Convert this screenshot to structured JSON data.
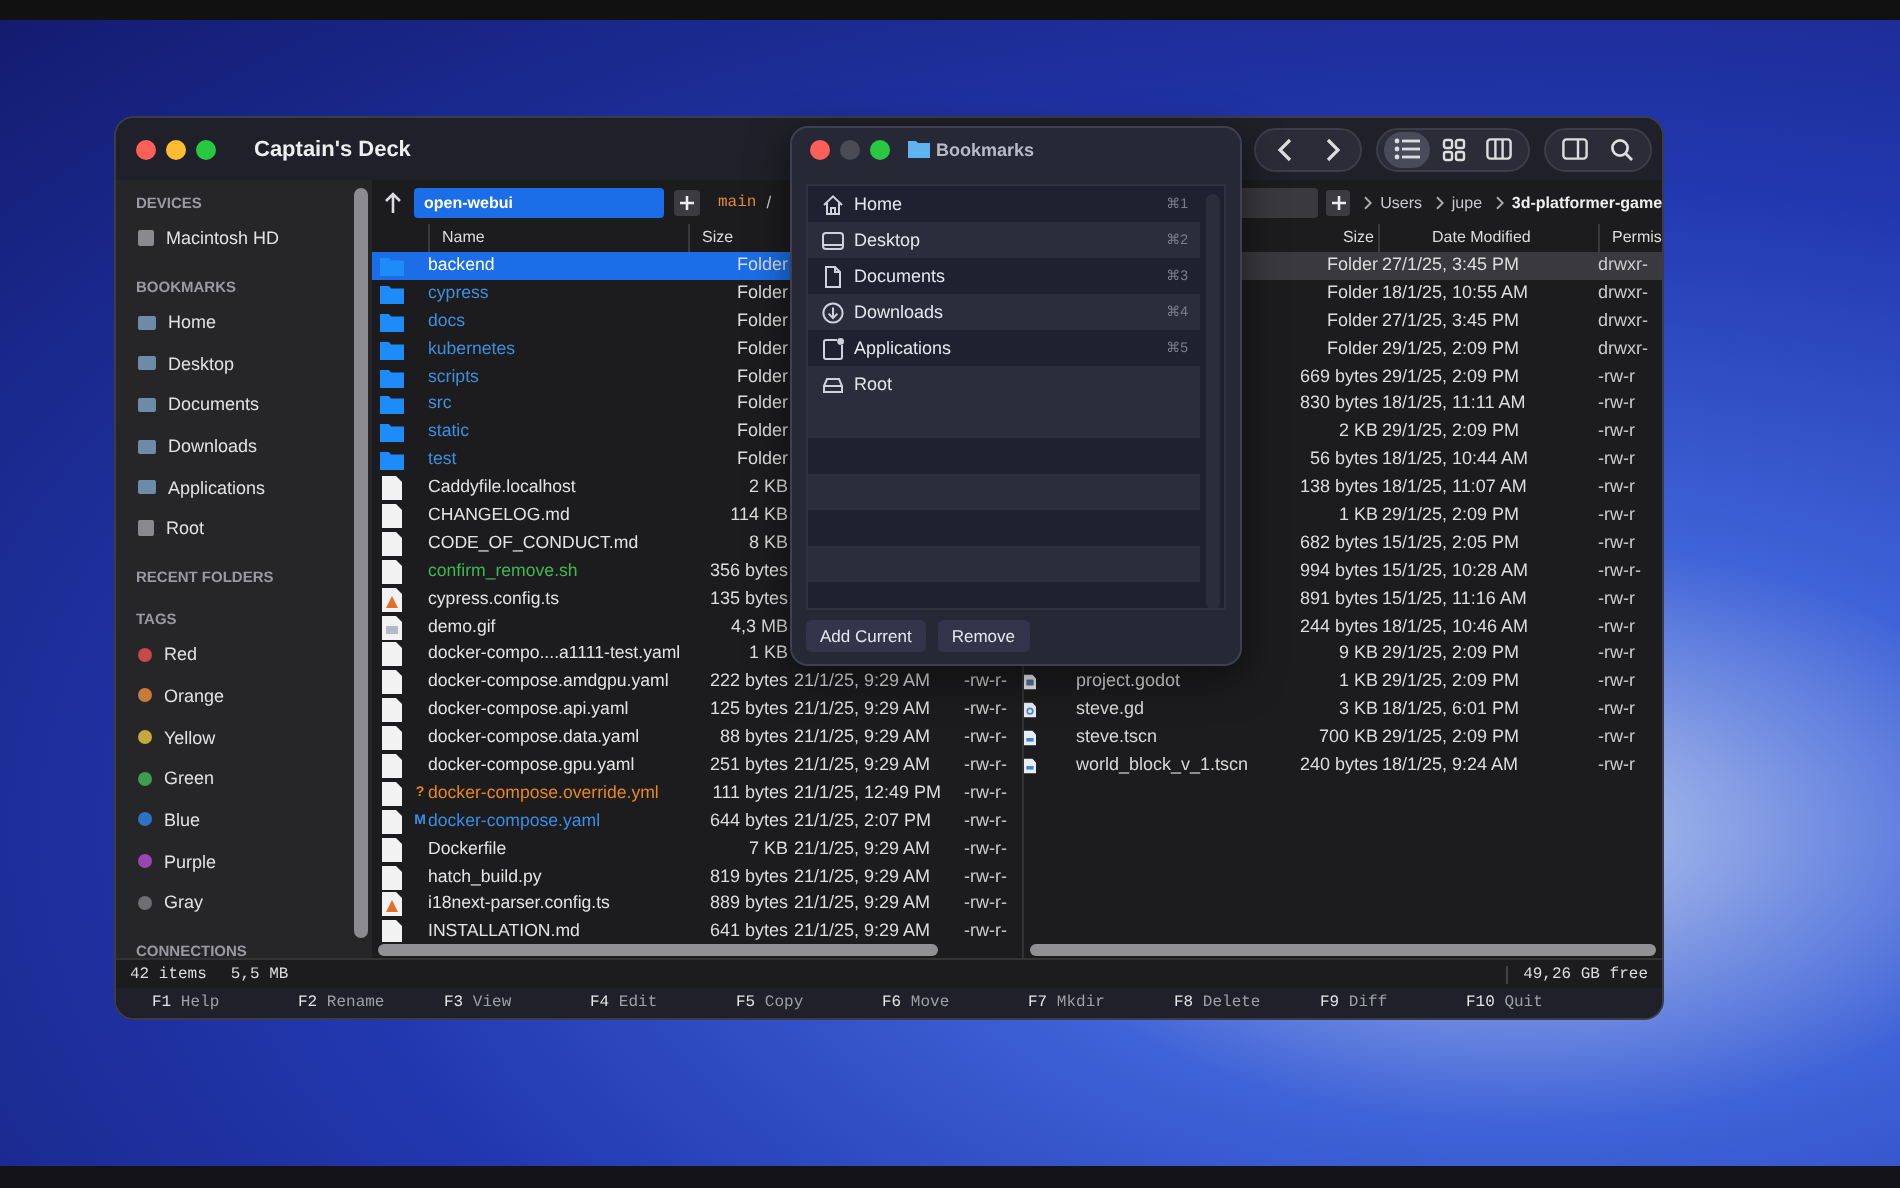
{
  "window": {
    "title": "Captain's Deck"
  },
  "toolbar": {
    "view_modes": [
      {
        "kind": "list",
        "selected": true
      },
      {
        "kind": "grid",
        "selected": false
      },
      {
        "kind": "columns",
        "selected": false
      }
    ]
  },
  "sidebar": {
    "sections": [
      {
        "heading": "DEVICES",
        "items": [
          {
            "label": "Macintosh HD",
            "kind": "drive"
          }
        ]
      },
      {
        "heading": "BOOKMARKS",
        "items": [
          {
            "label": "Home",
            "kind": "folder"
          },
          {
            "label": "Desktop",
            "kind": "folder"
          },
          {
            "label": "Documents",
            "kind": "folder"
          },
          {
            "label": "Downloads",
            "kind": "folder"
          },
          {
            "label": "Applications",
            "kind": "folder"
          },
          {
            "label": "Root",
            "kind": "drive"
          }
        ]
      },
      {
        "heading": "RECENT FOLDERS"
      },
      {
        "heading": "TAGS",
        "items": [
          {
            "label": "Red",
            "kind": "tag",
            "color": "#c9484b"
          },
          {
            "label": "Orange",
            "kind": "tag",
            "color": "#c77a3a"
          },
          {
            "label": "Yellow",
            "kind": "tag",
            "color": "#c2a93a"
          },
          {
            "label": "Green",
            "kind": "tag",
            "color": "#3e9d4f"
          },
          {
            "label": "Blue",
            "kind": "tag",
            "color": "#2f72c4"
          },
          {
            "label": "Purple",
            "kind": "tag",
            "color": "#9a45b0"
          },
          {
            "label": "Gray",
            "kind": "tag",
            "color": "#6e6e73"
          }
        ]
      },
      {
        "heading": "CONNECTIONS"
      }
    ]
  },
  "left_panel": {
    "focused": true,
    "path": "open-webui",
    "branch": "main",
    "branch_separator": "/",
    "columns": [
      "Name",
      "Size"
    ],
    "rows": [
      {
        "name": "backend",
        "size": "Folder",
        "kind": "folder",
        "selected": true
      },
      {
        "name": "cypress",
        "size": "Folder",
        "kind": "folder",
        "selected": false
      },
      {
        "name": "docs",
        "size": "Folder",
        "kind": "folder",
        "selected": false
      },
      {
        "name": "kubernetes",
        "size": "Folder",
        "kind": "folder",
        "selected": false
      },
      {
        "name": "scripts",
        "size": "Folder",
        "kind": "folder",
        "selected": false
      },
      {
        "name": "src",
        "size": "Folder",
        "kind": "folder",
        "selected": false
      },
      {
        "name": "static",
        "size": "Folder",
        "kind": "folder",
        "selected": false
      },
      {
        "name": "test",
        "size": "Folder",
        "kind": "folder",
        "selected": false
      },
      {
        "name": "Caddyfile.localhost",
        "size": "2 KB",
        "kind": "file",
        "selected": false
      },
      {
        "name": "CHANGELOG.md",
        "size": "114 KB",
        "kind": "file",
        "selected": false
      },
      {
        "name": "CODE_OF_CONDUCT.md",
        "size": "8 KB",
        "kind": "file",
        "selected": false
      },
      {
        "name": "confirm_remove.sh",
        "size": "356 bytes",
        "kind": "file",
        "selected": false,
        "color": "#3fb950"
      },
      {
        "name": "cypress.config.ts",
        "size": "135 bytes",
        "kind": "config",
        "selected": false
      },
      {
        "name": "demo.gif",
        "size": "4,3 MB",
        "kind": "image",
        "selected": false
      },
      {
        "name": "docker-compo....a1111-test.yaml",
        "size": "1 KB",
        "kind": "file",
        "selected": false
      },
      {
        "name": "docker-compose.amdgpu.yaml",
        "size": "222 bytes",
        "date": "21/1/25, 9:29 AM",
        "permissions": "-rw-r-",
        "kind": "file",
        "selected": false
      },
      {
        "name": "docker-compose.api.yaml",
        "size": "125 bytes",
        "date": "21/1/25, 9:29 AM",
        "permissions": "-rw-r-",
        "kind": "file",
        "selected": false
      },
      {
        "name": "docker-compose.data.yaml",
        "size": "88 bytes",
        "date": "21/1/25, 9:29 AM",
        "permissions": "-rw-r-",
        "kind": "file",
        "selected": false
      },
      {
        "name": "docker-compose.gpu.yaml",
        "size": "251 bytes",
        "date": "21/1/25, 9:29 AM",
        "permissions": "-rw-r-",
        "kind": "file",
        "selected": false
      },
      {
        "name": "docker-compose.override.yml",
        "size": "111 bytes",
        "date": "21/1/25, 12:49 PM",
        "permissions": "-rw-r-",
        "kind": "file",
        "selected": false,
        "color": "#e8871e",
        "git_status": "?"
      },
      {
        "name": "docker-compose.yaml",
        "size": "644 bytes",
        "date": "21/1/25, 2:07 PM",
        "permissions": "-rw-r-",
        "kind": "file",
        "selected": false,
        "color": "#3a8ee6",
        "git_status": "M"
      },
      {
        "name": "Dockerfile",
        "size": "7 KB",
        "date": "21/1/25, 9:29 AM",
        "permissions": "-rw-r-",
        "kind": "file",
        "selected": false
      },
      {
        "name": "hatch_build.py",
        "size": "819 bytes",
        "date": "21/1/25, 9:29 AM",
        "permissions": "-rw-r-",
        "kind": "file",
        "selected": false
      },
      {
        "name": "i18next-parser.config.ts",
        "size": "889 bytes",
        "date": "21/1/25, 9:29 AM",
        "permissions": "-rw-r-",
        "kind": "config",
        "selected": false
      },
      {
        "name": "INSTALLATION.md",
        "size": "641 bytes",
        "date": "21/1/25, 9:29 AM",
        "permissions": "-rw-r-",
        "kind": "file",
        "selected": false
      }
    ]
  },
  "right_panel": {
    "focused": false,
    "breadcrumb": [
      "Users",
      "jupe",
      "3d-platformer-game"
    ],
    "columns": [
      "Size",
      "Date Modified",
      "Permis"
    ],
    "rows": [
      {
        "size": "Folder",
        "date": "27/1/25, 3:45 PM",
        "permissions": "drwxr-",
        "selected": true
      },
      {
        "size": "Folder",
        "date": "18/1/25, 10:55 AM",
        "permissions": "drwxr-",
        "selected": false
      },
      {
        "size": "Folder",
        "date": "27/1/25, 3:45 PM",
        "permissions": "drwxr-",
        "selected": false
      },
      {
        "size": "Folder",
        "date": "29/1/25, 2:09 PM",
        "permissions": "drwxr-",
        "selected": false
      },
      {
        "size": "669 bytes",
        "date": "29/1/25, 2:09 PM",
        "permissions": "-rw-r",
        "selected": false
      },
      {
        "size": "830 bytes",
        "date": "18/1/25, 11:11 AM",
        "permissions": "-rw-r",
        "selected": false
      },
      {
        "size": "2 KB",
        "date": "29/1/25, 2:09 PM",
        "permissions": "-rw-r",
        "selected": false
      },
      {
        "size": "56 bytes",
        "date": "18/1/25, 10:44 AM",
        "permissions": "-rw-r",
        "selected": false
      },
      {
        "size": "138 bytes",
        "date": "18/1/25, 11:07 AM",
        "permissions": "-rw-r",
        "selected": false
      },
      {
        "size": "1 KB",
        "date": "29/1/25, 2:09 PM",
        "permissions": "-rw-r",
        "selected": false
      },
      {
        "size": "682 bytes",
        "date": "15/1/25, 2:05 PM",
        "permissions": "-rw-r",
        "selected": false
      },
      {
        "size": "994 bytes",
        "date": "15/1/25, 10:28 AM",
        "permissions": "-rw-r-",
        "selected": false
      },
      {
        "size": "891 bytes",
        "date": "15/1/25, 11:16 AM",
        "permissions": "-rw-r",
        "selected": false
      },
      {
        "size": "244 bytes",
        "date": "18/1/25, 10:46 AM",
        "permissions": "-rw-r",
        "selected": false
      },
      {
        "size": "9 KB",
        "date": "29/1/25, 2:09 PM",
        "permissions": "-rw-r",
        "selected": false
      },
      {
        "name": "project.godot",
        "kind": "project",
        "size": "1 KB",
        "date": "29/1/25, 2:09 PM",
        "permissions": "-rw-r",
        "selected": false
      },
      {
        "name": "steve.gd",
        "kind": "script",
        "size": "3 KB",
        "date": "18/1/25, 6:01 PM",
        "permissions": "-rw-r",
        "selected": false
      },
      {
        "name": "steve.tscn",
        "kind": "scene",
        "size": "700 KB",
        "date": "29/1/25, 2:09 PM",
        "permissions": "-rw-r",
        "selected": false
      },
      {
        "name": "world_block_v_1.tscn",
        "kind": "scene",
        "size": "240 bytes",
        "date": "18/1/25, 9:24 AM",
        "permissions": "-rw-r",
        "selected": false
      }
    ]
  },
  "status_bar": {
    "item_count": "42 items",
    "total_size": "5,5 MB",
    "free_space": "49,26 GB free"
  },
  "function_keys": [
    {
      "key": "F1",
      "label": "Help"
    },
    {
      "key": "F2",
      "label": "Rename"
    },
    {
      "key": "F3",
      "label": "View"
    },
    {
      "key": "F4",
      "label": "Edit"
    },
    {
      "key": "F5",
      "label": "Copy"
    },
    {
      "key": "F6",
      "label": "Move"
    },
    {
      "key": "F7",
      "label": "Mkdir"
    },
    {
      "key": "F8",
      "label": "Delete"
    },
    {
      "key": "F9",
      "label": "Diff"
    },
    {
      "key": "F10",
      "label": "Quit"
    }
  ],
  "bookmarks_dialog": {
    "title": "Bookmarks",
    "items": [
      {
        "label": "Home",
        "kind": "home",
        "shortcut": "⌘1"
      },
      {
        "label": "Desktop",
        "kind": "desktop",
        "shortcut": "⌘2"
      },
      {
        "label": "Documents",
        "kind": "document",
        "shortcut": "⌘3"
      },
      {
        "label": "Downloads",
        "kind": "download",
        "shortcut": "⌘4"
      },
      {
        "label": "Applications",
        "kind": "application",
        "shortcut": "⌘5"
      },
      {
        "label": "Root",
        "kind": "drive"
      }
    ],
    "buttons": [
      "Add Current",
      "Remove"
    ]
  }
}
